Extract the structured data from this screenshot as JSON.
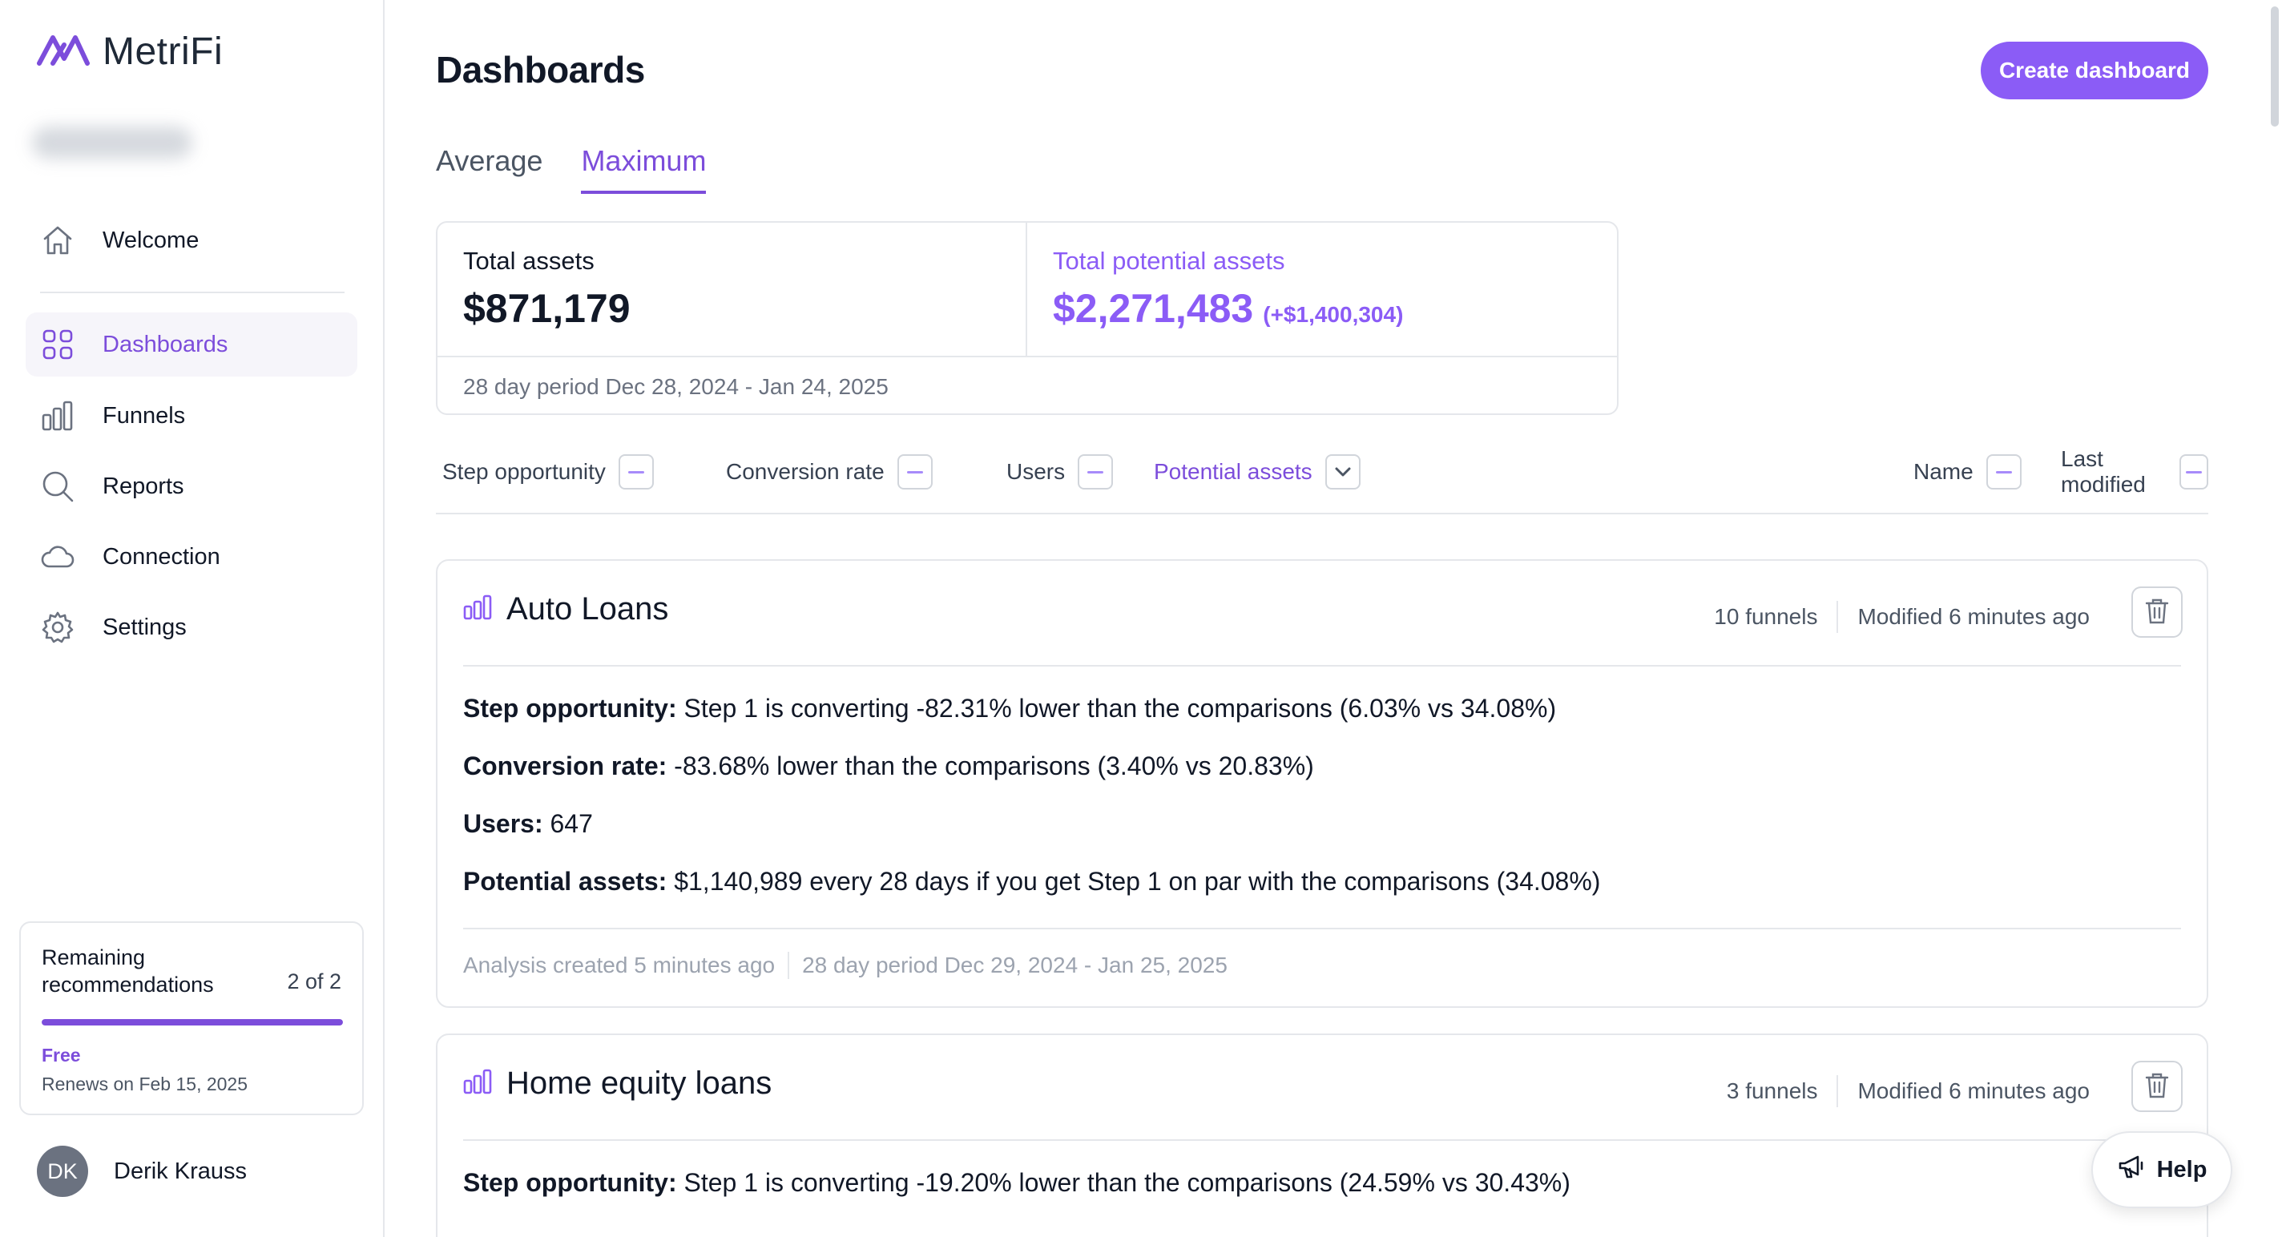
{
  "brand": {
    "name": "MetriFi",
    "logo_icon": "metrifi-logo-icon",
    "accent": "#7c4ddb"
  },
  "sidebar": {
    "items": [
      {
        "label": "Welcome",
        "icon": "home-icon"
      },
      {
        "label": "Dashboards",
        "icon": "grid-icon",
        "active": true
      },
      {
        "label": "Funnels",
        "icon": "bar-chart-icon"
      },
      {
        "label": "Reports",
        "icon": "search-icon"
      },
      {
        "label": "Connection",
        "icon": "cloud-icon"
      },
      {
        "label": "Settings",
        "icon": "gear-icon"
      }
    ],
    "recommendations": {
      "title": "Remaining recommendations",
      "count": "2 of 2",
      "progress": 1.0,
      "plan": "Free",
      "renews": "Renews on Feb 15, 2025"
    },
    "user": {
      "initials": "DK",
      "name": "Derik Krauss"
    }
  },
  "header": {
    "title": "Dashboards",
    "create_label": "Create dashboard"
  },
  "tabs": [
    {
      "label": "Average"
    },
    {
      "label": "Maximum",
      "active": true
    }
  ],
  "assets": {
    "total_label": "Total assets",
    "total_value": "$871,179",
    "potential_label": "Total potential assets",
    "potential_value": "$2,271,483",
    "potential_delta": "(+$1,400,304)",
    "period": "28 day period Dec 28, 2024 - Jan 24, 2025"
  },
  "sort": {
    "step_opportunity": "Step opportunity",
    "conversion_rate": "Conversion rate",
    "users": "Users",
    "potential_assets": "Potential assets",
    "name": "Name",
    "last_modified": "Last modified"
  },
  "dashboards": [
    {
      "title": "Auto Loans",
      "funnels": "10 funnels",
      "modified": "Modified 6 minutes ago",
      "lines": [
        {
          "label": "Step opportunity:",
          "text": "Step 1 is converting -82.31% lower than the comparisons (6.03% vs 34.08%)"
        },
        {
          "label": "Conversion rate:",
          "text": "-83.68% lower than the comparisons (3.40% vs 20.83%)"
        },
        {
          "label": "Users:",
          "text": "647"
        },
        {
          "label": "Potential assets:",
          "text": "$1,140,989 every 28 days if you get Step 1 on par with the comparisons (34.08%)"
        }
      ],
      "analysis": "Analysis created 5 minutes ago",
      "period": "28 day period Dec 29, 2024 - Jan 25, 2025"
    },
    {
      "title": "Home equity loans",
      "funnels": "3 funnels",
      "modified": "Modified 6 minutes ago",
      "lines": [
        {
          "label": "Step opportunity:",
          "text": "Step 1 is converting -19.20% lower than the comparisons (24.59% vs 30.43%)"
        }
      ]
    }
  ],
  "help": {
    "label": "Help",
    "icon": "megaphone-icon"
  }
}
